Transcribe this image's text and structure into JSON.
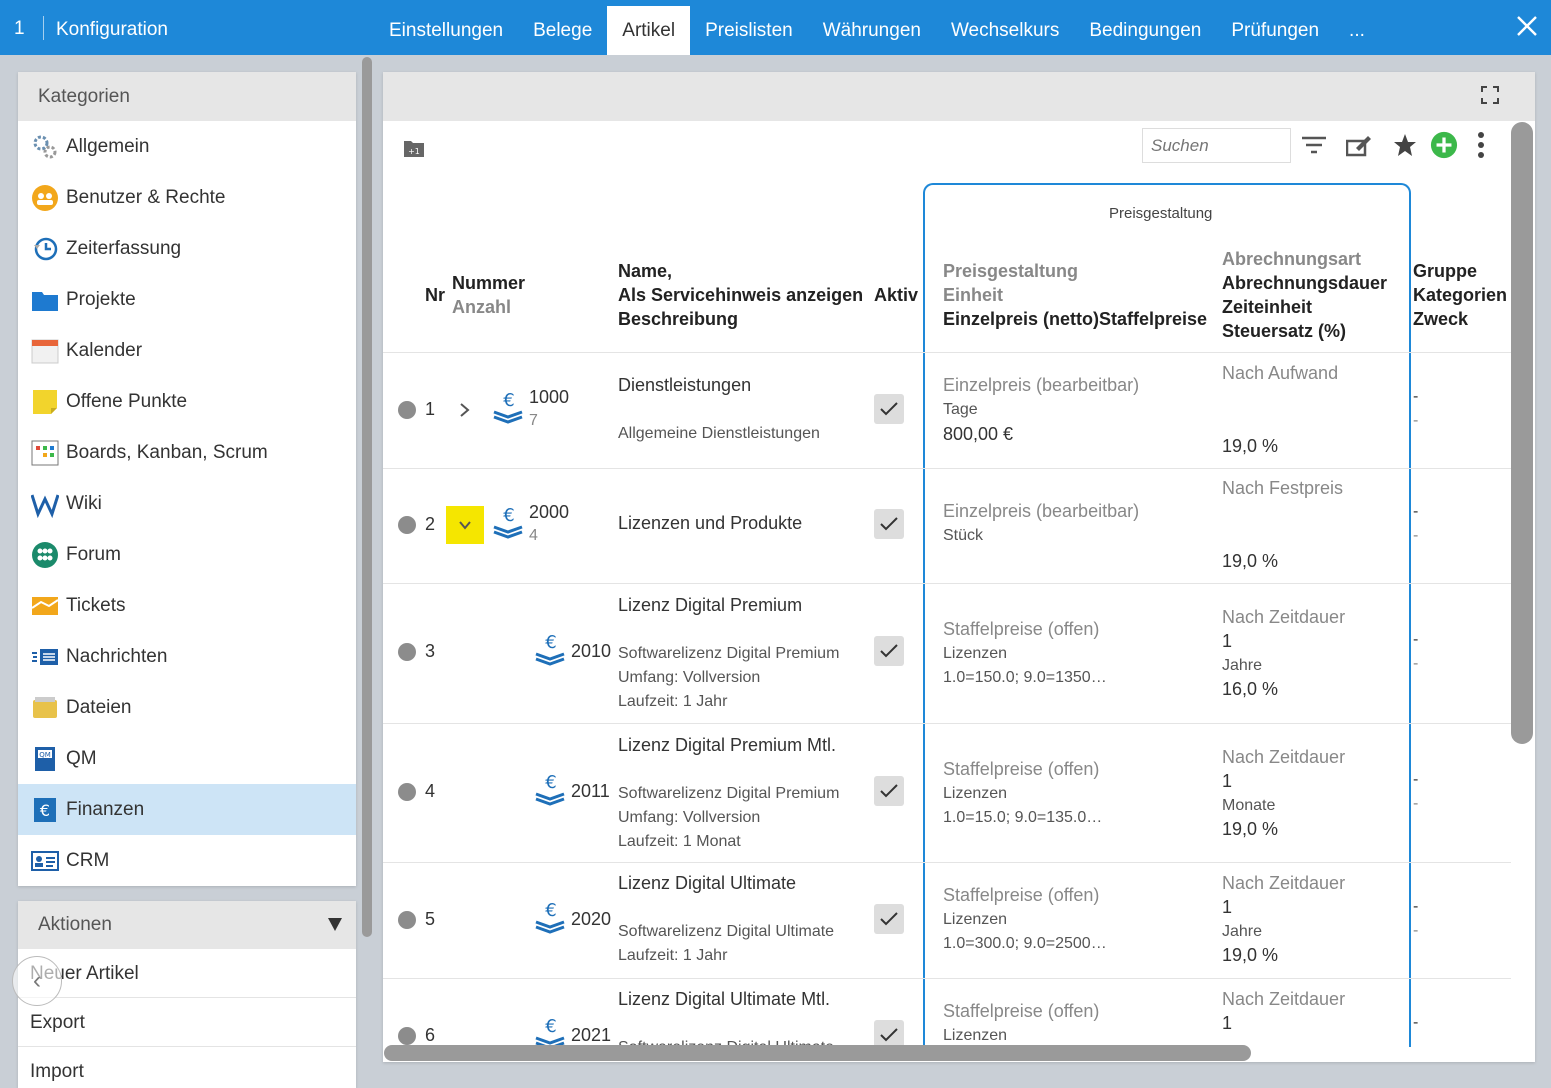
{
  "window": {
    "number": "1",
    "title": "Konfiguration",
    "tabs": [
      "Einstellungen",
      "Belege",
      "Artikel",
      "Preislisten",
      "Währungen",
      "Wechselkurs",
      "Bedingungen",
      "Prüfungen",
      "..."
    ],
    "active_tab": "Artikel"
  },
  "sidebar": {
    "header": "Kategorien",
    "items": [
      {
        "label": "Allgemein",
        "icon": "gears-icon"
      },
      {
        "label": "Benutzer & Rechte",
        "icon": "users-icon"
      },
      {
        "label": "Zeiterfassung",
        "icon": "clock-history-icon"
      },
      {
        "label": "Projekte",
        "icon": "folder-icon"
      },
      {
        "label": "Kalender",
        "icon": "calendar-icon"
      },
      {
        "label": "Offene Punkte",
        "icon": "sticky-note-icon"
      },
      {
        "label": "Boards, Kanban, Scrum",
        "icon": "kanban-icon"
      },
      {
        "label": "Wiki",
        "icon": "wiki-icon"
      },
      {
        "label": "Forum",
        "icon": "forum-icon"
      },
      {
        "label": "Tickets",
        "icon": "tickets-icon"
      },
      {
        "label": "Nachrichten",
        "icon": "messages-icon"
      },
      {
        "label": "Dateien",
        "icon": "files-icon"
      },
      {
        "label": "QM",
        "icon": "qm-book-icon"
      },
      {
        "label": "Finanzen",
        "icon": "euro-icon"
      },
      {
        "label": "CRM",
        "icon": "crm-card-icon"
      }
    ],
    "active_item": "Finanzen"
  },
  "actions": {
    "header": "Aktionen",
    "items": [
      "Neuer Artikel",
      "Export",
      "Import"
    ]
  },
  "toolbar": {
    "search_placeholder": "Suchen"
  },
  "table": {
    "group_header": "Preisgestaltung",
    "columns": {
      "nr": "Nr",
      "nummer": "Nummer",
      "anzahl": "Anzahl",
      "name": "Name,",
      "servicehinweis": "Als Servicehinweis anzeigen",
      "beschreibung": "Beschreibung",
      "aktiv": "Aktiv",
      "preisgestaltung": "Preisgestaltung",
      "einheit": "Einheit",
      "einzelpreis": "Einzelpreis (netto)",
      "staffelpreise": "Staffelpreise",
      "abrechnungsart": "Abrechnungsart",
      "abrechnungsdauer": "Abrechnungsdauer",
      "zeiteinheit": "Zeiteinheit",
      "steuersatz": "Steuersatz (%)",
      "gruppe": "Gruppe",
      "kategorien": "Kategorien",
      "zweck": "Zweck"
    },
    "rows": [
      {
        "nr": "1",
        "nummer": "1000",
        "anzahl": "7",
        "name": "Dienstleistungen",
        "desc": [
          "Allgemeine Dienstleistungen"
        ],
        "preis": "Einzelpreis (bearbeitbar)",
        "einheit": "Tage",
        "wert": "800,00 €",
        "art": "Nach Aufwand",
        "dauer": "",
        "zeit": "",
        "steuer": "19,0 %",
        "gruppe": "-",
        "kat": "-"
      },
      {
        "nr": "2",
        "nummer": "2000",
        "anzahl": "4",
        "name": "Lizenzen und Produkte",
        "desc": [],
        "preis": "Einzelpreis (bearbeitbar)",
        "einheit": "Stück",
        "wert": "",
        "art": "Nach Festpreis",
        "dauer": "",
        "zeit": "",
        "steuer": "19,0 %",
        "gruppe": "-",
        "kat": "-"
      },
      {
        "nr": "3",
        "nummer": "2010",
        "anzahl": "",
        "name": "Lizenz Digital Premium",
        "desc": [
          "Softwarelizenz Digital Premium",
          "Umfang: Vollversion",
          "Laufzeit: 1 Jahr"
        ],
        "preis": "Staffelpreise (offen)",
        "einheit": "Lizenzen",
        "wert": "1.0=150.0; 9.0=1350…",
        "art": "Nach Zeitdauer",
        "dauer": "1",
        "zeit": "Jahre",
        "steuer": "16,0 %",
        "gruppe": "-",
        "kat": "-"
      },
      {
        "nr": "4",
        "nummer": "2011",
        "anzahl": "",
        "name": "Lizenz Digital Premium Mtl.",
        "desc": [
          "Softwarelizenz Digital Premium",
          "Umfang: Vollversion",
          "Laufzeit: 1 Monat"
        ],
        "preis": "Staffelpreise (offen)",
        "einheit": "Lizenzen",
        "wert": "1.0=15.0; 9.0=135.0…",
        "art": "Nach Zeitdauer",
        "dauer": "1",
        "zeit": "Monate",
        "steuer": "19,0 %",
        "gruppe": "-",
        "kat": "-"
      },
      {
        "nr": "5",
        "nummer": "2020",
        "anzahl": "",
        "name": "Lizenz Digital Ultimate",
        "desc": [
          "Softwarelizenz Digital Ultimate",
          "Laufzeit: 1 Jahr"
        ],
        "preis": "Staffelpreise (offen)",
        "einheit": "Lizenzen",
        "wert": "1.0=300.0; 9.0=2500…",
        "art": "Nach Zeitdauer",
        "dauer": "1",
        "zeit": "Jahre",
        "steuer": "19,0 %",
        "gruppe": "-",
        "kat": "-"
      },
      {
        "nr": "6",
        "nummer": "2021",
        "anzahl": "",
        "name": "Lizenz Digital Ultimate Mtl.",
        "desc": [
          "Softwarelizenz Digital Ultimate"
        ],
        "preis": "Staffelpreise (offen)",
        "einheit": "Lizenzen",
        "wert": "",
        "art": "Nach Zeitdauer",
        "dauer": "1",
        "zeit": "",
        "steuer": "",
        "gruppe": "-",
        "kat": ""
      }
    ]
  },
  "colors": {
    "accent": "#1e88d8",
    "active_item": "#cde4f6",
    "highlight": "#f5e600",
    "add_button": "#3cb84a"
  }
}
